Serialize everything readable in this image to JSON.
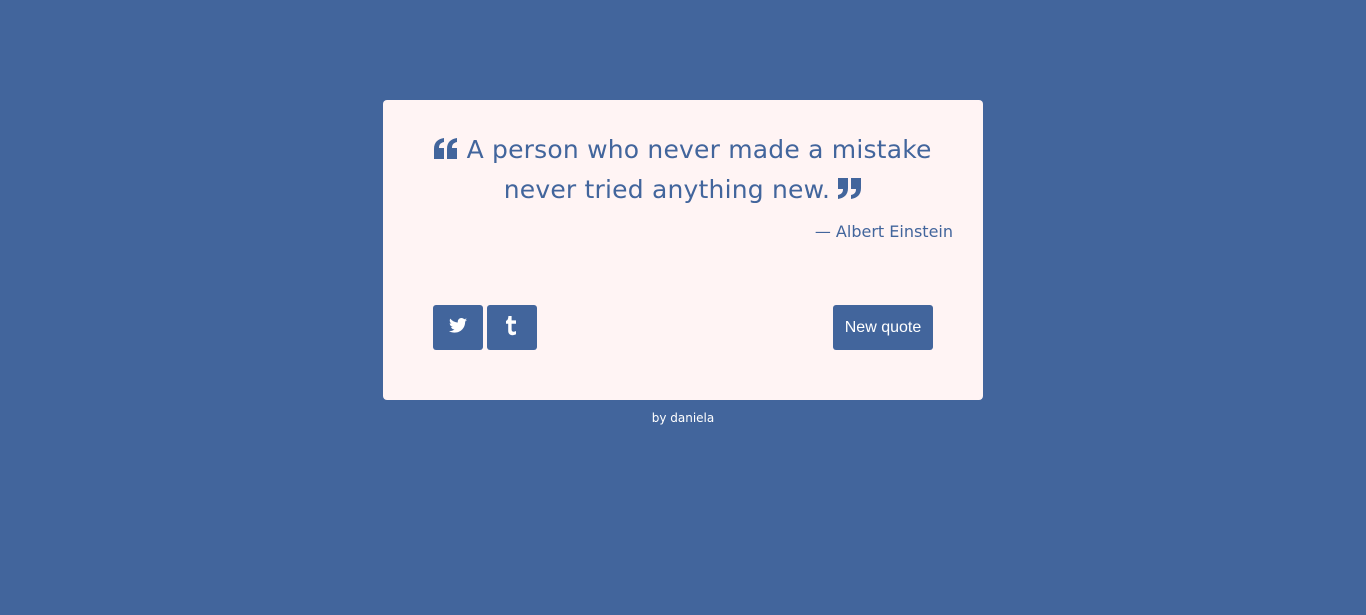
{
  "quote": {
    "text": "A person who never made a mistake never tried anything new.",
    "author": "— Albert Einstein",
    "open_icon": "quote-left-icon",
    "close_icon": "quote-right-icon"
  },
  "buttons": {
    "twitter_icon": "twitter-icon",
    "tumblr_icon": "tumblr-icon",
    "new_quote_label": "New quote"
  },
  "footer": {
    "credit": "by daniela"
  },
  "colors": {
    "background": "#42659c",
    "card": "#fff4f4",
    "accent": "#42659c",
    "button_text": "#ffffff"
  }
}
